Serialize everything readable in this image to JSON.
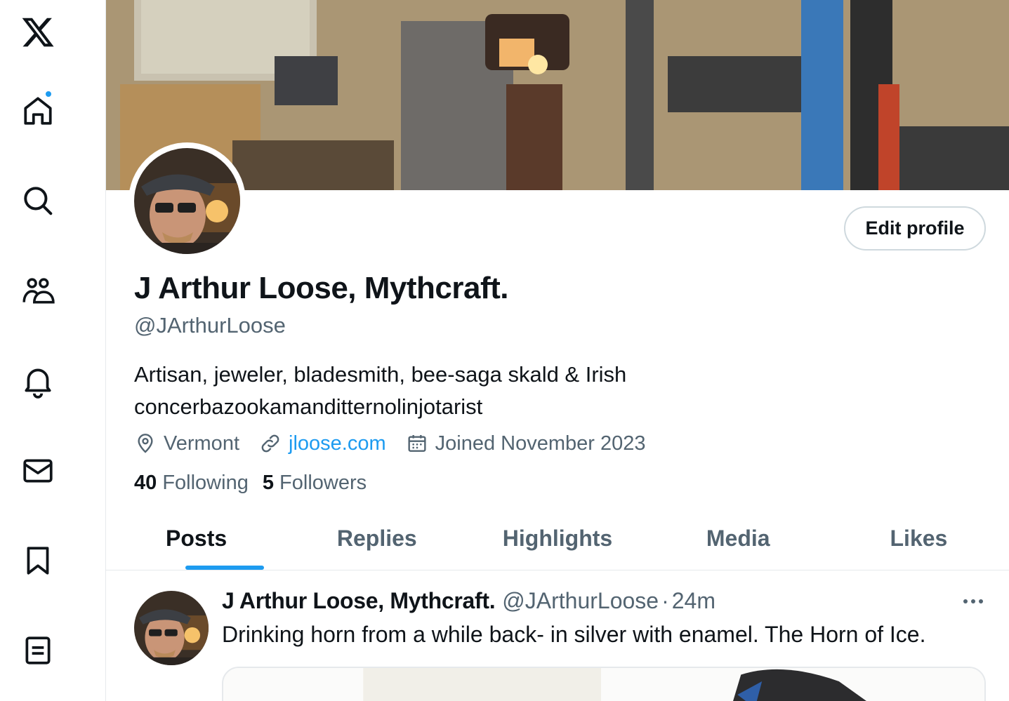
{
  "sidebar": {
    "items": [
      {
        "name": "x-logo-icon"
      },
      {
        "name": "home-icon",
        "has_notification_dot": true
      },
      {
        "name": "search-icon"
      },
      {
        "name": "communities-icon"
      },
      {
        "name": "notifications-icon"
      },
      {
        "name": "messages-icon"
      },
      {
        "name": "bookmarks-icon"
      },
      {
        "name": "lists-icon"
      }
    ]
  },
  "profile": {
    "display_name": "J Arthur Loose, Mythcraft.",
    "handle": "@JArthurLoose",
    "bio_line1": "Artisan, jeweler, bladesmith, bee-saga skald & Irish",
    "bio_line2": "concerbazookamanditternolinjotarist",
    "location": "Vermont",
    "website": "jloose.com",
    "joined": "Joined November 2023",
    "following_count": "40",
    "following_label": "Following",
    "followers_count": "5",
    "followers_label": "Followers",
    "edit_button": "Edit profile"
  },
  "tabs": [
    {
      "label": "Posts",
      "active": true
    },
    {
      "label": "Replies",
      "active": false
    },
    {
      "label": "Highlights",
      "active": false
    },
    {
      "label": "Media",
      "active": false
    },
    {
      "label": "Likes",
      "active": false
    }
  ],
  "post": {
    "author_name": "J Arthur Loose, Mythcraft.",
    "author_handle": "@JArthurLoose",
    "separator": "·",
    "time": "24m",
    "text": "Drinking horn from a while back- in silver with enamel. The Horn of Ice."
  },
  "colors": {
    "accent": "#1d9bf0",
    "text_primary": "#0f1419",
    "text_secondary": "#536471",
    "border": "#e6e9ec"
  }
}
